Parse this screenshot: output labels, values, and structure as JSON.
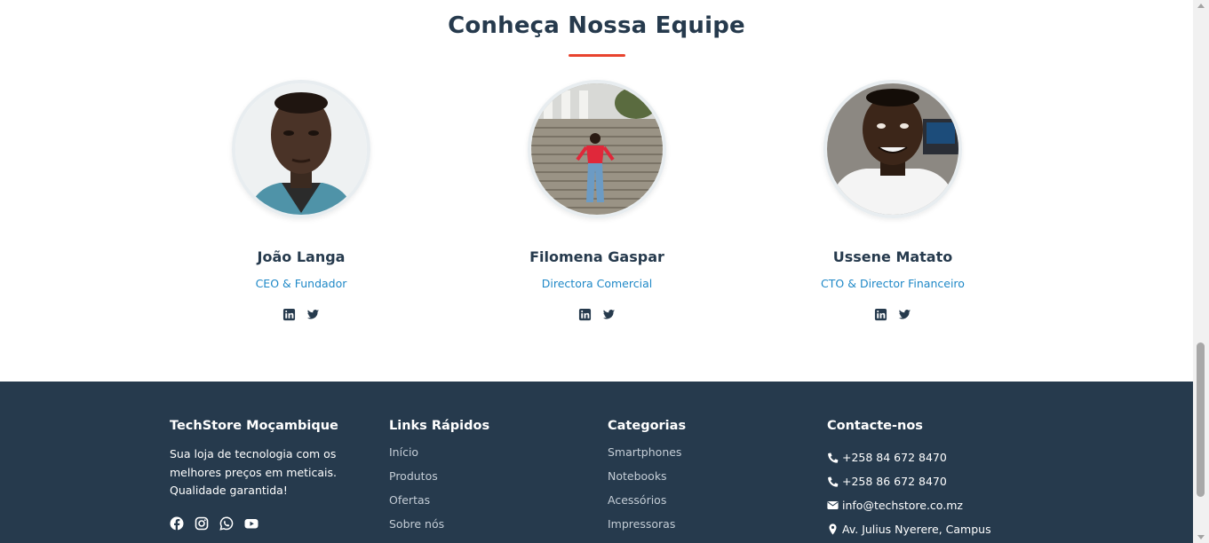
{
  "team": {
    "title": "Conheça Nossa Equipe",
    "members": [
      {
        "name": "João Langa",
        "role": "CEO & Fundador",
        "photo": "portrait-photo"
      },
      {
        "name": "Filomena Gaspar",
        "role": "Directora Comercial",
        "photo": "portrait-photo"
      },
      {
        "name": "Ussene Matato",
        "role": "CTO & Director Financeiro",
        "photo": "portrait-photo"
      }
    ],
    "social_icons": [
      "linkedin-icon",
      "twitter-icon"
    ]
  },
  "footer": {
    "about": {
      "title": "TechStore Moçambique",
      "description_lines": [
        "Sua loja de tecnologia com os",
        "melhores preços em meticais.",
        "Qualidade garantida!"
      ],
      "social_icons": [
        "facebook-icon",
        "instagram-icon",
        "whatsapp-icon",
        "youtube-icon"
      ]
    },
    "quick_links": {
      "title": "Links Rápidos",
      "items": [
        "Início",
        "Produtos",
        "Ofertas",
        "Sobre nós"
      ]
    },
    "categories": {
      "title": "Categorias",
      "items": [
        "Smartphones",
        "Notebooks",
        "Acessórios",
        "Impressoras"
      ]
    },
    "contact": {
      "title": "Contacte-nos",
      "items": [
        {
          "icon": "phone-icon",
          "text": "+258 84 672 8470"
        },
        {
          "icon": "phone-icon",
          "text": "+258 86 672 8470"
        },
        {
          "icon": "envelope-icon",
          "text": "info@techstore.co.mz"
        },
        {
          "icon": "map-pin-icon",
          "text": "Av. Julius Nyerere, Campus"
        }
      ]
    }
  },
  "colors": {
    "heading": "#263a4d",
    "accent_red": "#e8432e",
    "role_blue": "#1e88c7",
    "footer_bg": "#263a4d",
    "footer_link": "#c4cdd6"
  }
}
